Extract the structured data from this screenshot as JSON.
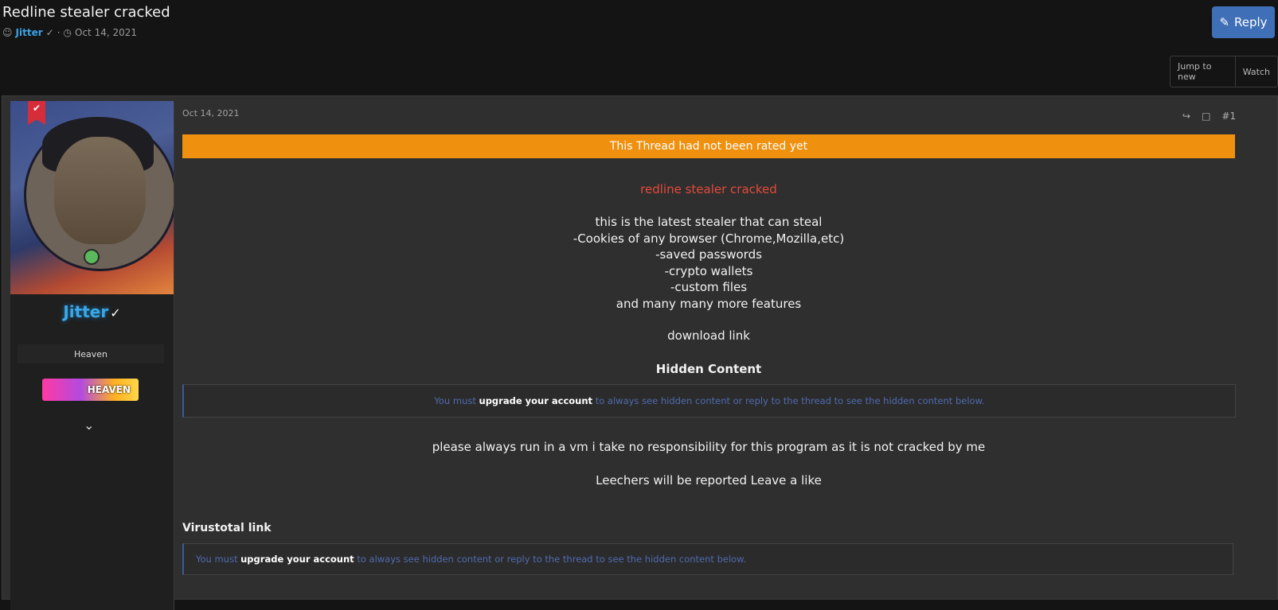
{
  "thread": {
    "title": "Redline stealer cracked",
    "author": "Jitter",
    "date": "Oct 14, 2021"
  },
  "toolbar": {
    "reply_label": "Reply",
    "jump_label": "Jump to new",
    "watch_label": "Watch"
  },
  "post": {
    "date": "Oct 14, 2021",
    "number": "#1",
    "rating_banner": "This Thread had not been rated yet",
    "heading": "redline stealer cracked",
    "lines": [
      "this is the latest stealer that can steal",
      "-Cookies of any browser (Chrome,Mozilla,etc)",
      "-saved passwords",
      "-crypto wallets",
      "-custom files",
      "and many many more features"
    ],
    "download_label": "download link",
    "hidden_title": "Hidden Content",
    "hidden_prefix": "You must ",
    "hidden_link": "upgrade your account",
    "hidden_suffix": " to always see hidden content or reply to the thread to see the hidden content below.",
    "warning": "please always run in a vm i take no responsibility for this program as it is not cracked by me",
    "leechers": "Leechers will be reported Leave a like",
    "virustotal_title": "Virustotal link"
  },
  "user": {
    "name": "Jitter",
    "rank": "Heaven",
    "banner": "HEAVEN"
  }
}
